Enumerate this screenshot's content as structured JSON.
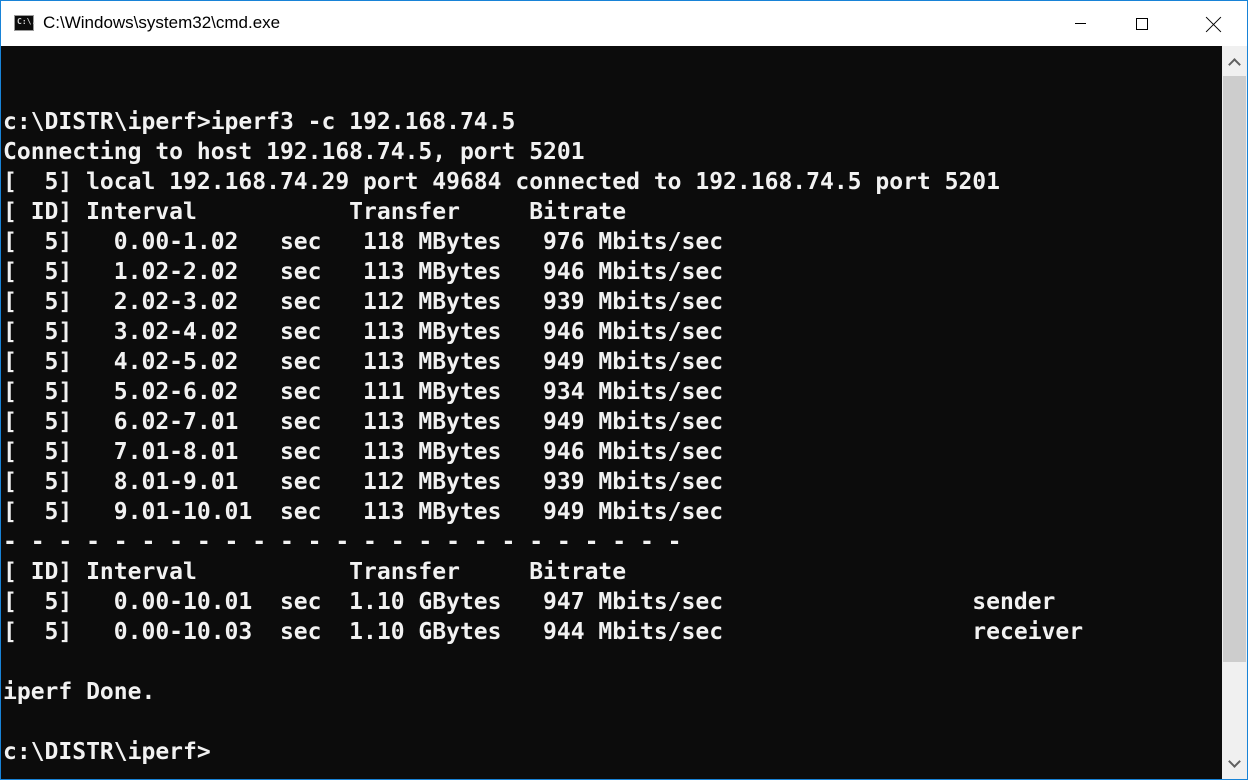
{
  "window": {
    "title": "C:\\Windows\\system32\\cmd.exe",
    "icon": "cmd-icon",
    "icon_glyph": "C:\\.",
    "border_color": "#1883d7"
  },
  "console": {
    "background": "#0c0c0c",
    "foreground": "#f2f2f2",
    "lines": [
      "",
      "c:\\DISTR\\iperf>iperf3 -c 192.168.74.5",
      "Connecting to host 192.168.74.5, port 5201",
      "[  5] local 192.168.74.29 port 49684 connected to 192.168.74.5 port 5201",
      "[ ID] Interval           Transfer     Bitrate",
      "[  5]   0.00-1.02   sec   118 MBytes   976 Mbits/sec",
      "[  5]   1.02-2.02   sec   113 MBytes   946 Mbits/sec",
      "[  5]   2.02-3.02   sec   112 MBytes   939 Mbits/sec",
      "[  5]   3.02-4.02   sec   113 MBytes   946 Mbits/sec",
      "[  5]   4.02-5.02   sec   113 MBytes   949 Mbits/sec",
      "[  5]   5.02-6.02   sec   111 MBytes   934 Mbits/sec",
      "[  5]   6.02-7.01   sec   113 MBytes   949 Mbits/sec",
      "[  5]   7.01-8.01   sec   113 MBytes   946 Mbits/sec",
      "[  5]   8.01-9.01   sec   112 MBytes   939 Mbits/sec",
      "[  5]   9.01-10.01  sec   113 MBytes   949 Mbits/sec",
      "- - - - - - - - - - - - - - - - - - - - - - - - -",
      "[ ID] Interval           Transfer     Bitrate",
      "[  5]   0.00-10.01  sec  1.10 GBytes   947 Mbits/sec                  sender",
      "[  5]   0.00-10.03  sec  1.10 GBytes   944 Mbits/sec                  receiver",
      "",
      "iperf Done.",
      "",
      "c:\\DISTR\\iperf>"
    ]
  },
  "controls": {
    "minimize_icon": "minimize-icon",
    "maximize_icon": "maximize-icon",
    "close_icon": "close-icon"
  }
}
